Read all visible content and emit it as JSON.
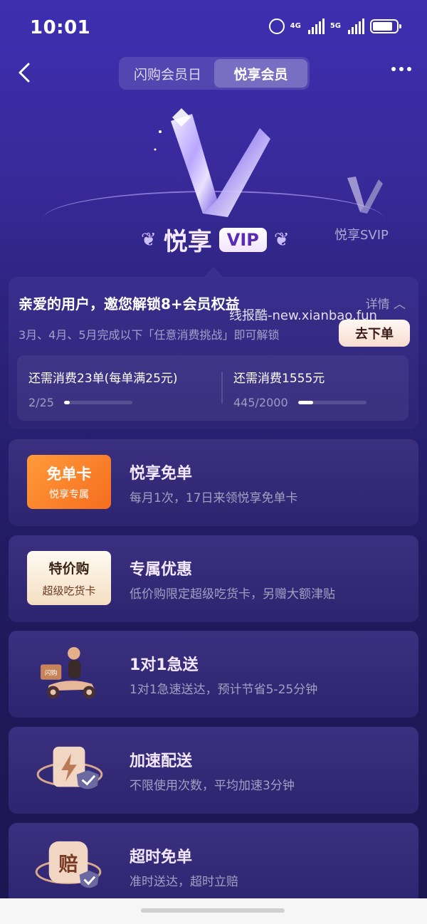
{
  "status_bar": {
    "time": "10:01",
    "network_1": "4G",
    "network_2": "5G"
  },
  "nav": {
    "tabs": [
      {
        "label": "闪购会员日",
        "active": false
      },
      {
        "label": "悦享会员",
        "active": true
      }
    ]
  },
  "hero": {
    "tier_name": "悦享",
    "tier_badge": "VIP",
    "next_tier": "悦享SVIP"
  },
  "invite": {
    "title": "亲爱的用户，邀您解锁8+会员权益",
    "detail_label": "详情",
    "subtitle": "3月、4月、5月完成以下「任意消费挑战」即可解锁",
    "order_button": "去下单",
    "watermark": "线报酷-new.xianbao.fun",
    "challenges": [
      {
        "label": "还需消费23单(每单满25元)",
        "progress_text": "2/25",
        "progress": 0.08
      },
      {
        "label": "还需消费1555元",
        "progress_text": "445/2000",
        "progress": 0.2225
      }
    ]
  },
  "benefits": [
    {
      "title": "悦享免单",
      "desc": "每月1次，17日来领悦享免单卡",
      "icon": "free-order-card-icon",
      "card_line1": "免单卡",
      "card_line2": "悦享专属"
    },
    {
      "title": "专属优惠",
      "desc": "低价购限定超级吃货卡，另赠大额津贴",
      "icon": "special-price-card-icon",
      "card_line1": "特价购",
      "card_line2": "超级吃货卡"
    },
    {
      "title": "1对1急送",
      "desc": "1对1急速送达，预计节省5-25分钟",
      "icon": "courier-scooter-icon",
      "card_text": "闪购"
    },
    {
      "title": "加速配送",
      "desc": "不限使用次数，平均加速3分钟",
      "icon": "lightning-shield-icon"
    },
    {
      "title": "超时免单",
      "desc": "准时送达，超时立赔",
      "icon": "compensation-badge-icon",
      "card_text": "赔"
    }
  ]
}
